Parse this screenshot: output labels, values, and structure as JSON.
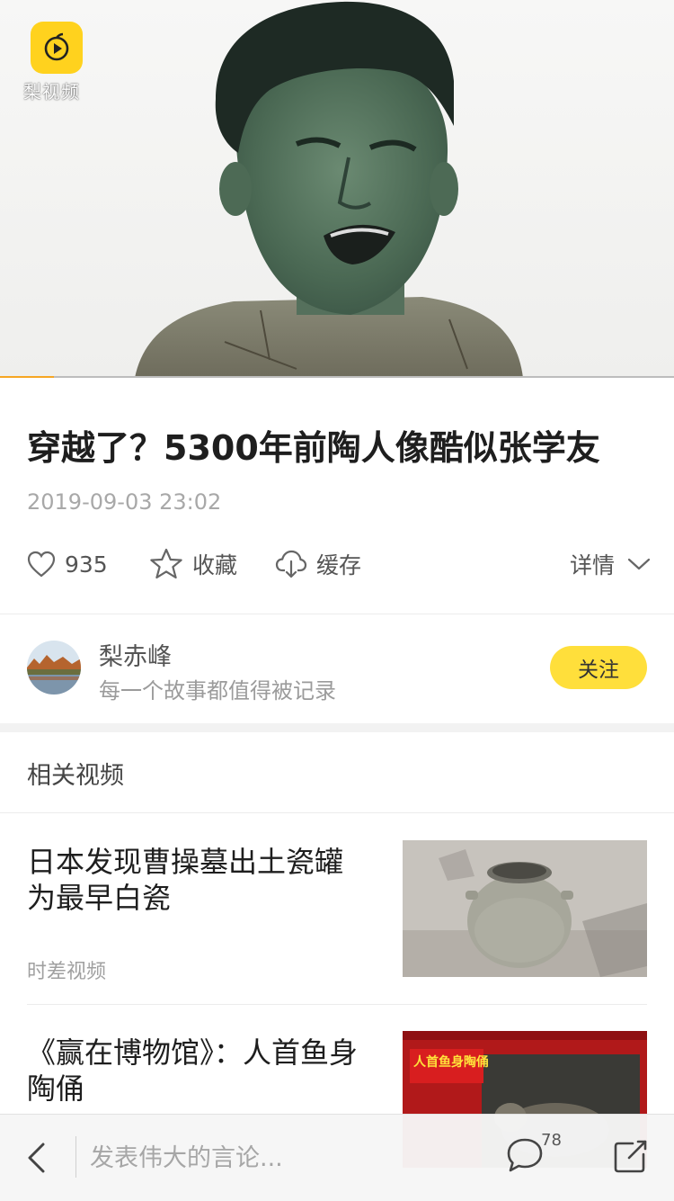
{
  "app": {
    "logo_text": "梨视频"
  },
  "video": {
    "progress_percent": 8
  },
  "article": {
    "title": "穿越了？5300年前陶人像酷似张学友",
    "date": "2019-09-03 23:02",
    "like_count": "935",
    "favorite_label": "收藏",
    "cache_label": "缓存",
    "details_label": "详情"
  },
  "author": {
    "name": "梨赤峰",
    "bio": "每一个故事都值得被记录",
    "follow_label": "关注"
  },
  "related": {
    "section_title": "相关视频",
    "items": [
      {
        "title": "日本发现曹操墓出土瓷罐为最早白瓷",
        "source": "时差视频",
        "thumb": "porcelain-jar"
      },
      {
        "title": "《赢在博物馆》：人首鱼身陶俑",
        "source": "",
        "thumb": "pottery-figurine",
        "thumb_caption": "人首鱼身陶俑"
      }
    ]
  },
  "bottom_bar": {
    "comment_placeholder": "发表伟大的言论...",
    "comment_count": "78"
  },
  "icons": [
    "heart-icon",
    "star-icon",
    "cloud-download-icon",
    "chevron-down-icon",
    "back-icon",
    "comment-icon",
    "share-icon",
    "play-icon"
  ],
  "colors": {
    "accent_yellow": "#ffdf3b",
    "logo_yellow": "#ffd21e",
    "progress_orange": "#f6a623"
  }
}
